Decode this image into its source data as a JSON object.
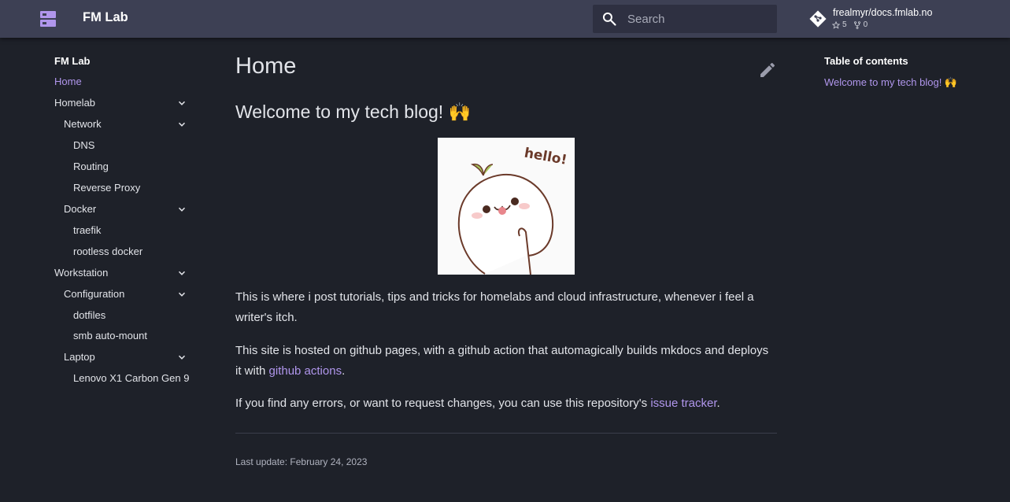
{
  "header": {
    "site_title": "FM Lab",
    "logo_icon": "server-icon",
    "search": {
      "placeholder": "Search",
      "value": ""
    },
    "repo": {
      "name": "frealmyr/docs.fmlab.no",
      "stars": "5",
      "forks": "0"
    }
  },
  "nav": {
    "title": "FM Lab",
    "items": [
      {
        "label": "Home",
        "active": true
      },
      {
        "label": "Homelab",
        "expandable": true
      },
      {
        "label": "Network",
        "expandable": true
      },
      {
        "label": "DNS"
      },
      {
        "label": "Routing"
      },
      {
        "label": "Reverse Proxy"
      },
      {
        "label": "Docker",
        "expandable": true
      },
      {
        "label": "traefik"
      },
      {
        "label": "rootless docker"
      },
      {
        "label": "Workstation",
        "expandable": true
      },
      {
        "label": "Configuration",
        "expandable": true
      },
      {
        "label": "dotfiles"
      },
      {
        "label": "smb auto-mount"
      },
      {
        "label": "Laptop",
        "expandable": true
      },
      {
        "label": "Lenovo X1 Carbon Gen 9"
      }
    ]
  },
  "main": {
    "title": "Home",
    "heading": "Welcome to my tech blog! 🙌",
    "image_text": "hello!",
    "p1": "This is where i post tutorials, tips and tricks for homelabs and cloud infrastructure, whenever i feel a writer's itch.",
    "p2_before": "This site is hosted on github pages, with a github action that automagically builds mkdocs and deploys it with ",
    "p2_link": "github actions",
    "p2_after": ".",
    "p3_before": "If you find any errors, or want to request changes, you can use this repository's ",
    "p3_link": "issue tracker",
    "p3_after": ".",
    "last_update": "Last update: February 24, 2023"
  },
  "toc": {
    "title": "Table of contents",
    "items": [
      "Welcome to my tech blog! 🙌"
    ]
  },
  "colors": {
    "background": "#1e2129",
    "header": "#3d4054",
    "accent": "#b096ec"
  }
}
